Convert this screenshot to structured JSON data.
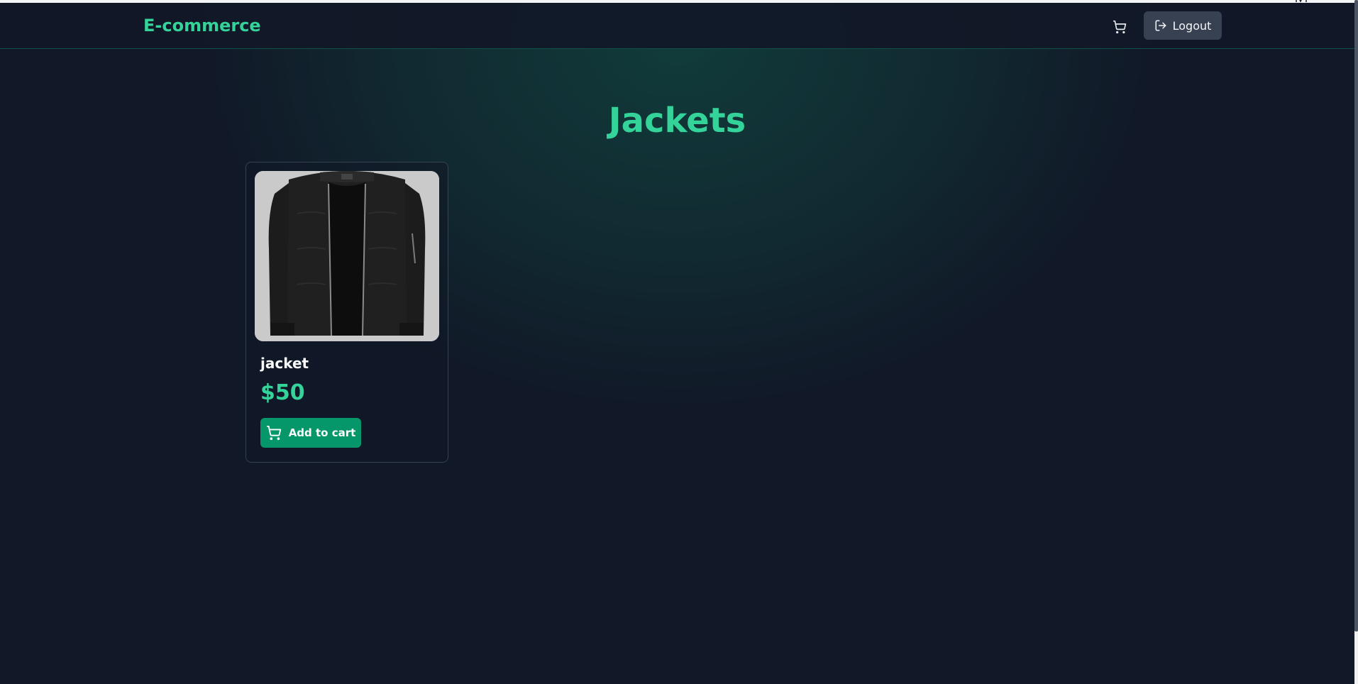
{
  "navbar": {
    "brand": "E-commerce",
    "cart_icon": "shopping-cart-icon",
    "logout_icon": "logout-icon",
    "logout_label": "Logout"
  },
  "page": {
    "title": "Jackets"
  },
  "products": [
    {
      "name": "jacket",
      "price": "$50",
      "image_icon": "jacket-image",
      "button_icon": "shopping-cart-icon",
      "button_label": "Add to cart"
    }
  ],
  "colors": {
    "background": "#111827",
    "accent": "#34d399",
    "button_primary": "#059669",
    "button_secondary": "#374151",
    "text": "#f9fafb"
  }
}
